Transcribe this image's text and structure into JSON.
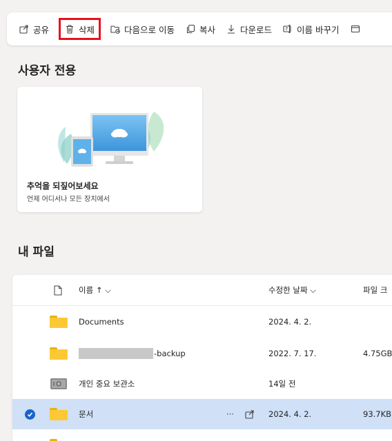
{
  "toolbar": {
    "share_label": "공유",
    "delete_label": "삭제",
    "move_label": "다음으로 이동",
    "copy_label": "복사",
    "download_label": "다운로드",
    "rename_label": "이름 바꾸기"
  },
  "for_you": {
    "title": "사용자 전용",
    "card_title": "추억을 되짚어보세요",
    "card_subtitle": "언제 어디서나 모든 장치에서"
  },
  "my_files": {
    "title": "내 파일",
    "columns": {
      "name": "이름 ↑ ⌵",
      "modified": "수정한 날짜 ⌵",
      "size": "파일 크"
    },
    "rows": [
      {
        "icon": "folder-icon",
        "name": "Documents",
        "modified": "2024. 4. 2.",
        "size": "",
        "selected": false
      },
      {
        "icon": "folder-icon",
        "name": "-backup",
        "modified": "2022. 7. 17.",
        "size": "4.75GB",
        "selected": false
      },
      {
        "icon": "vault-icon",
        "name": "개인 중요 보관소",
        "modified": "14일 전",
        "size": "",
        "selected": false
      },
      {
        "icon": "folder-icon",
        "name": "문서",
        "modified": "2024. 4. 2.",
        "size": "93.7KB",
        "selected": true
      }
    ],
    "more_actions": "···"
  },
  "colors": {
    "accent": "#1a64c6",
    "highlight": "#e8101a",
    "folder": "#fcc934",
    "selected_row": "#cfe0f7"
  }
}
